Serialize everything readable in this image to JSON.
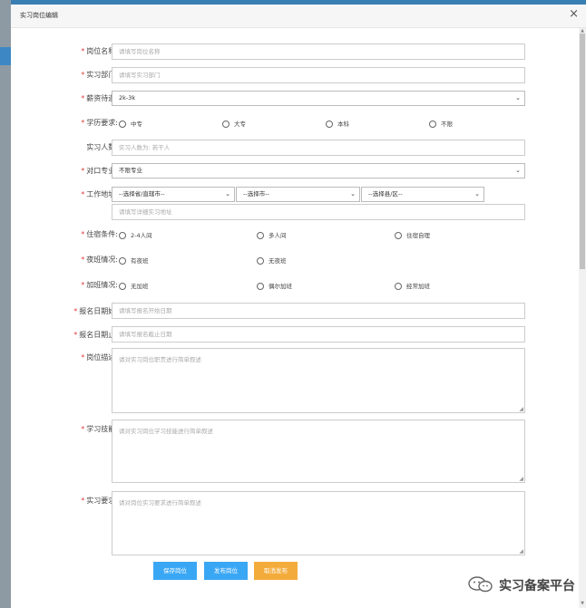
{
  "modal": {
    "title": "实习岗位编辑"
  },
  "fields": {
    "position_name": {
      "label": "岗位名称:",
      "placeholder": "请填写岗位名称"
    },
    "department": {
      "label": "实习部门:",
      "placeholder": "请填写实习部门"
    },
    "salary": {
      "label": "薪资待遇:",
      "value": "2k-3k"
    },
    "education": {
      "label": "学历要求:",
      "options": [
        "中专",
        "大专",
        "本科",
        "不限"
      ]
    },
    "headcount": {
      "label": "实习人数:",
      "placeholder": "实习人数为: 若干人"
    },
    "major": {
      "label": "对口专业:",
      "value": "不限专业"
    },
    "address": {
      "label": "工作地址:",
      "province": "--选择省/直辖市--",
      "city": "--选择市--",
      "district": "--选择县/区--",
      "detail_placeholder": "请填写详细实习地址"
    },
    "accommodation": {
      "label": "住宿条件:",
      "options": [
        "2-4人间",
        "多人间",
        "住宿自理"
      ]
    },
    "night_shift": {
      "label": "夜班情况:",
      "options": [
        "有夜班",
        "无夜班"
      ]
    },
    "overtime": {
      "label": "加班情况:",
      "options": [
        "无加班",
        "偶尔加班",
        "经常加班"
      ]
    },
    "signup_start": {
      "label": "报名日期始:",
      "placeholder": "请填写报名开始日期"
    },
    "signup_end": {
      "label": "报名日期止:",
      "placeholder": "请填写报名截止日期"
    },
    "description": {
      "label": "岗位描述:",
      "placeholder": "请对实习岗位职责进行简单叙述"
    },
    "skills": {
      "label": "学习技能:",
      "placeholder": "请对实习岗位学习技能进行简单叙述"
    },
    "requirements": {
      "label": "实习要求:",
      "placeholder": "请对岗位实习要求进行简单叙述"
    }
  },
  "buttons": {
    "save": "保存岗位",
    "publish": "发布岗位",
    "unpublish": "取消发布"
  },
  "colors": {
    "primary": "#3aa7f5",
    "warning": "#f3ac3b",
    "required": "#e23e3e"
  },
  "watermark": {
    "text": "实习备案平台",
    "icon": "wechat-icon"
  }
}
